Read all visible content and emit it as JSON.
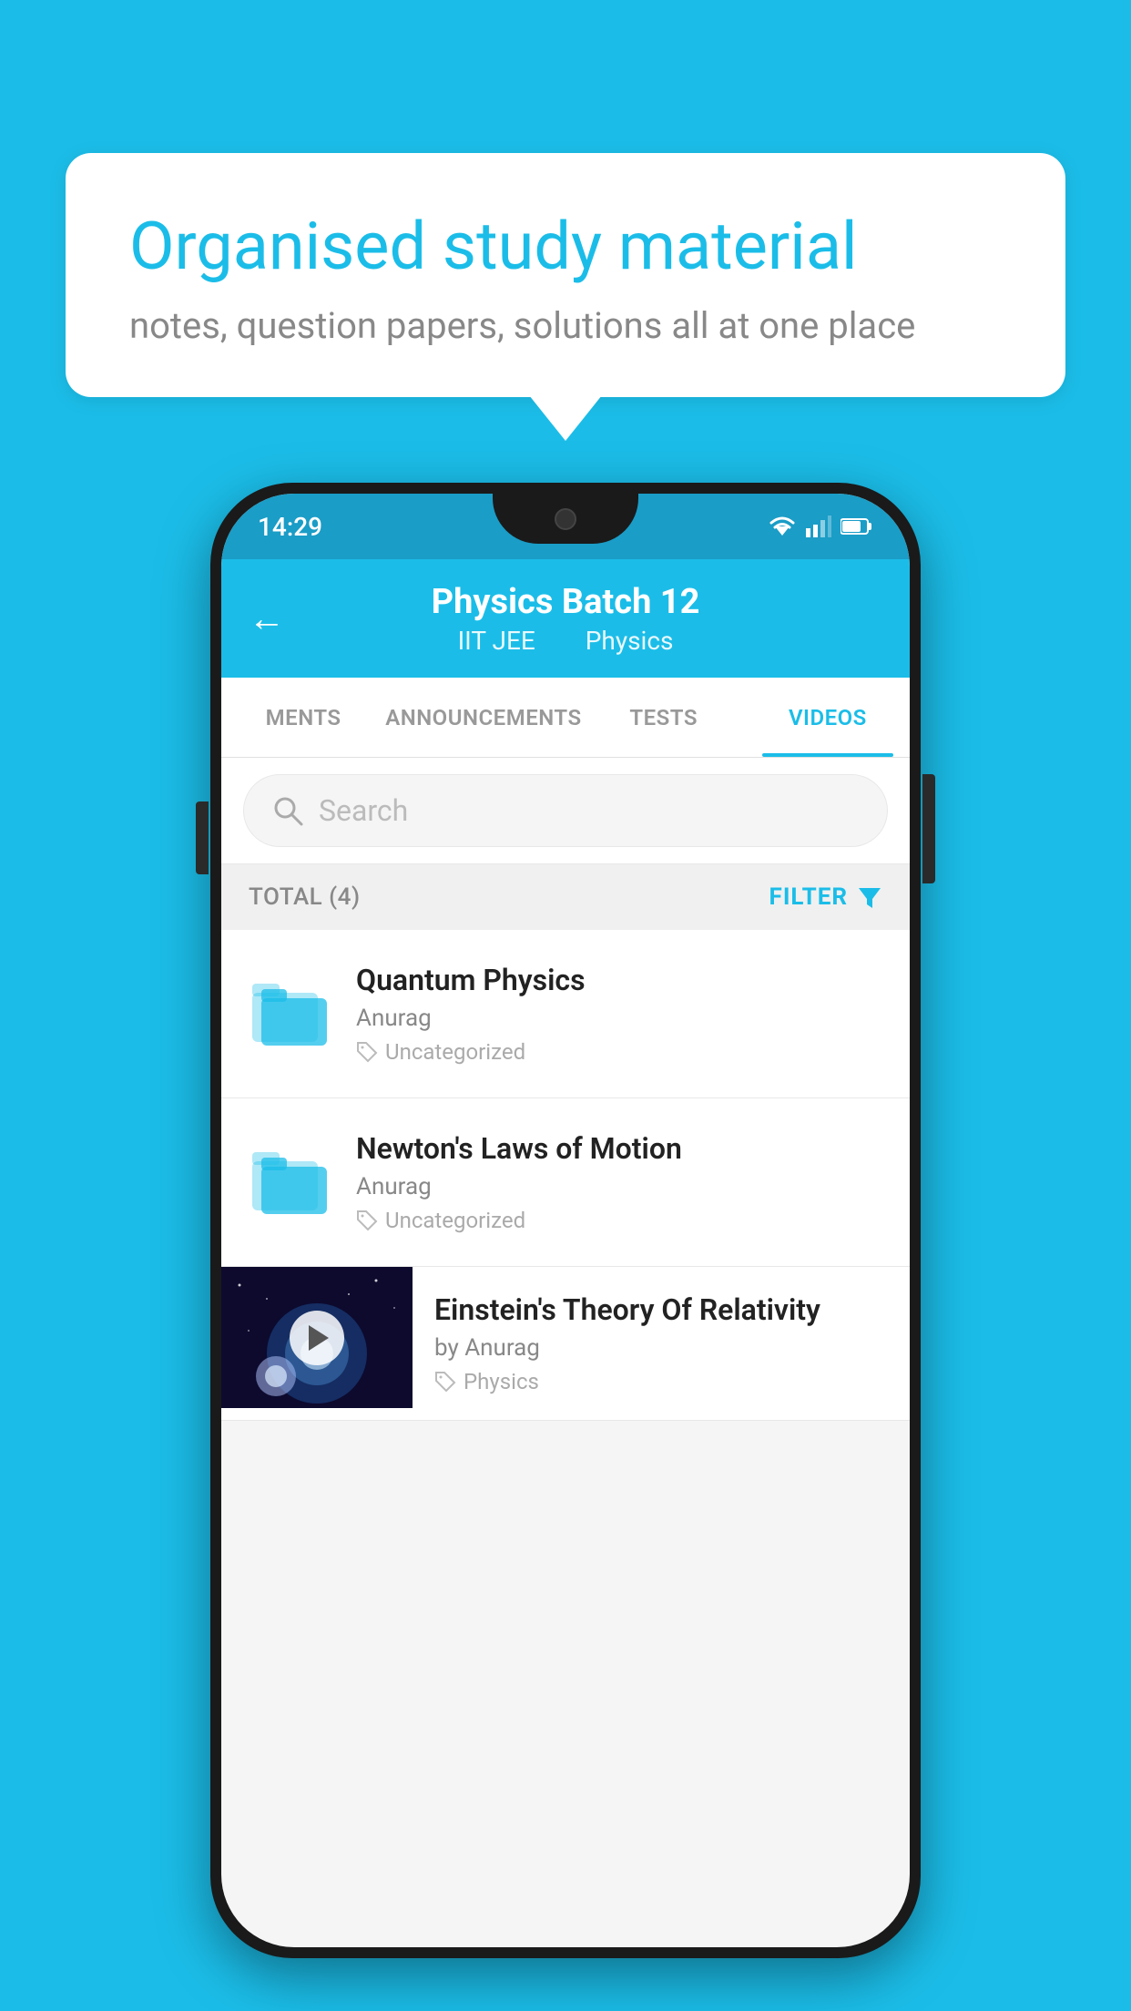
{
  "app": {
    "background_color": "#1bbde8"
  },
  "speech_bubble": {
    "title": "Organised study material",
    "subtitle": "notes, question papers, solutions all at one place"
  },
  "phone": {
    "status_bar": {
      "time": "14:29"
    },
    "app_bar": {
      "back_label": "←",
      "title": "Physics Batch 12",
      "subtitle_part1": "IIT JEE",
      "subtitle_part2": "Physics"
    },
    "tabs": [
      {
        "label": "MENTS",
        "active": false
      },
      {
        "label": "ANNOUNCEMENTS",
        "active": false
      },
      {
        "label": "TESTS",
        "active": false
      },
      {
        "label": "VIDEOS",
        "active": true
      }
    ],
    "search": {
      "placeholder": "Search"
    },
    "filter_bar": {
      "total_label": "TOTAL (4)",
      "filter_label": "FILTER"
    },
    "items": [
      {
        "id": 1,
        "type": "folder",
        "title": "Quantum Physics",
        "author": "Anurag",
        "tag": "Uncategorized"
      },
      {
        "id": 2,
        "type": "folder",
        "title": "Newton's Laws of Motion",
        "author": "Anurag",
        "tag": "Uncategorized"
      },
      {
        "id": 3,
        "type": "video",
        "title": "Einstein's Theory Of Relativity",
        "author": "by Anurag",
        "tag": "Physics"
      }
    ]
  }
}
